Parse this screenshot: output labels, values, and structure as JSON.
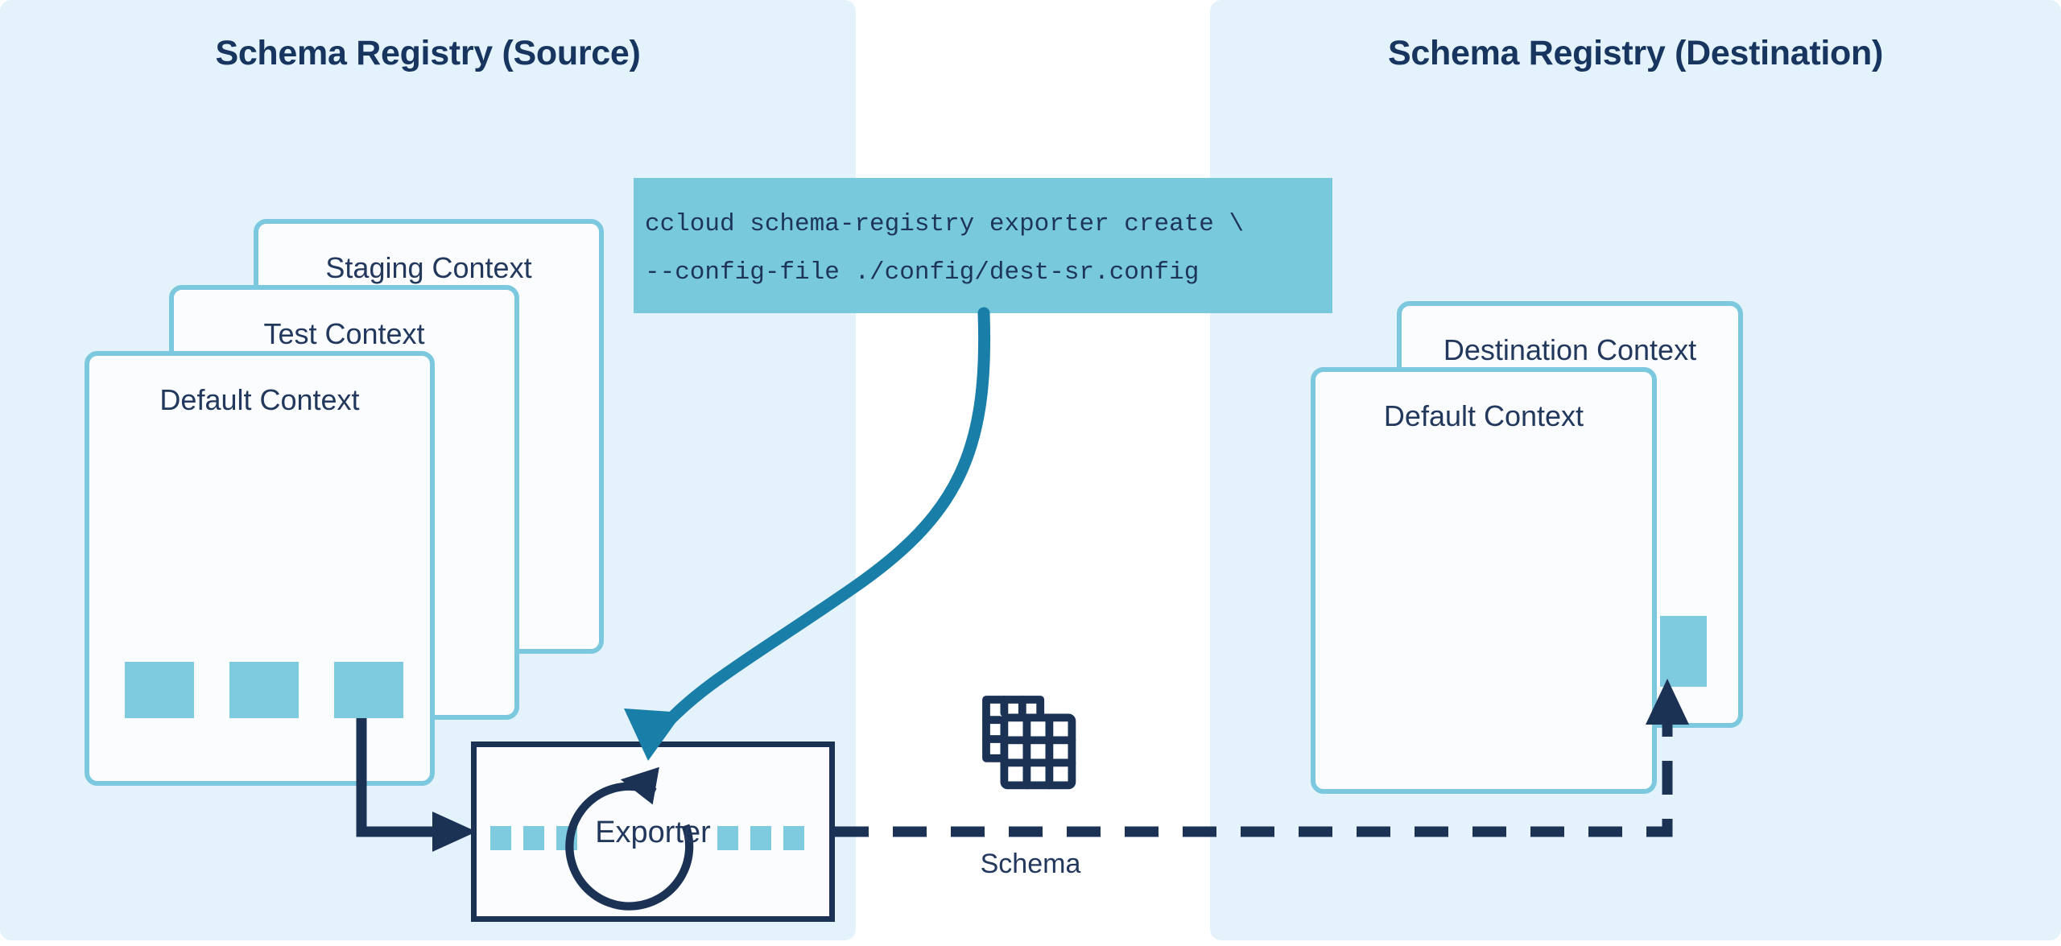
{
  "panels": {
    "source": {
      "title": "Schema Registry (Source)"
    },
    "destination": {
      "title": "Schema Registry (Destination)"
    }
  },
  "source_contexts": [
    {
      "label": "Staging Context"
    },
    {
      "label": "Test Context"
    },
    {
      "label": "Default Context"
    }
  ],
  "destination_contexts": [
    {
      "label": "Destination Context"
    },
    {
      "label": "Default Context"
    }
  ],
  "code_block": {
    "line1": "ccloud schema-registry exporter create \\",
    "line2": "--config-file ./config/dest-sr.config"
  },
  "exporter": {
    "label": "Exporter"
  },
  "schema_flow": {
    "label": "Schema"
  },
  "icons": {
    "schema": "schema-grid-icon",
    "refresh": "circular-refresh-arrow-icon"
  },
  "colors": {
    "panel_background": "#e3f2fb",
    "card_border": "#7cc8de",
    "card_fill": "#fafcfd",
    "accent_light_blue": "#7ecbe0",
    "accent_teal": "#1a7fa8",
    "navy": "#1b3255",
    "code_background": "#79c9dd",
    "title_text": "#17355e",
    "body_text": "#22385c"
  }
}
